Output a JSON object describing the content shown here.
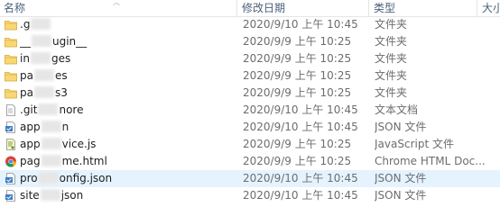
{
  "header": {
    "name": "名称",
    "date_modified": "修改日期",
    "type": "类型",
    "size": "大小"
  },
  "files": [
    {
      "icon": "folder-icon",
      "name_prefix": ".g",
      "name_suffix": "",
      "date": "2020/9/10 上午 10:45",
      "type": "文件夹"
    },
    {
      "icon": "folder-icon",
      "name_prefix": "__",
      "name_suffix": "ugin__",
      "date": "2020/9/9 上午 10:25",
      "type": "文件夹"
    },
    {
      "icon": "folder-icon",
      "name_prefix": "in",
      "name_suffix": "ges",
      "date": "2020/9/9 上午 10:25",
      "type": "文件夹"
    },
    {
      "icon": "folder-icon",
      "name_prefix": "pa",
      "name_suffix": "es",
      "date": "2020/9/9 上午 10:25",
      "type": "文件夹"
    },
    {
      "icon": "folder-icon",
      "name_prefix": "pa",
      "name_suffix": "s3",
      "date": "2020/9/9 上午 10:25",
      "type": "文件夹"
    },
    {
      "icon": "text-file-icon",
      "name_prefix": ".git",
      "name_suffix": "nore",
      "date": "2020/9/10 上午 10:45",
      "type": "文本文档"
    },
    {
      "icon": "json-file-icon",
      "name_prefix": "app",
      "name_suffix": "n",
      "date": "2020/9/10 上午 10:45",
      "type": "JSON 文件"
    },
    {
      "icon": "js-file-icon",
      "name_prefix": "app",
      "name_suffix": "vice.js",
      "date": "2020/9/9 上午 10:25",
      "type": "JavaScript 文件"
    },
    {
      "icon": "chrome-icon",
      "name_prefix": "pag",
      "name_suffix": "me.html",
      "date": "2020/9/9 上午 10:25",
      "type": "Chrome HTML Doc..."
    },
    {
      "icon": "json-file-icon",
      "name_prefix": "pro",
      "name_suffix": "onfig.json",
      "date": "2020/9/10 上午 10:45",
      "type": "JSON 文件",
      "selected": true
    },
    {
      "icon": "json-file-icon",
      "name_prefix": "site",
      "name_suffix": "json",
      "date": "2020/9/10 上午 10:45",
      "type": "JSON 文件"
    }
  ],
  "colors": {
    "header_text": "#4c607a",
    "selection": "#e5f3ff",
    "folder": "#f8d775",
    "secondary_text": "#6d6d6d"
  }
}
